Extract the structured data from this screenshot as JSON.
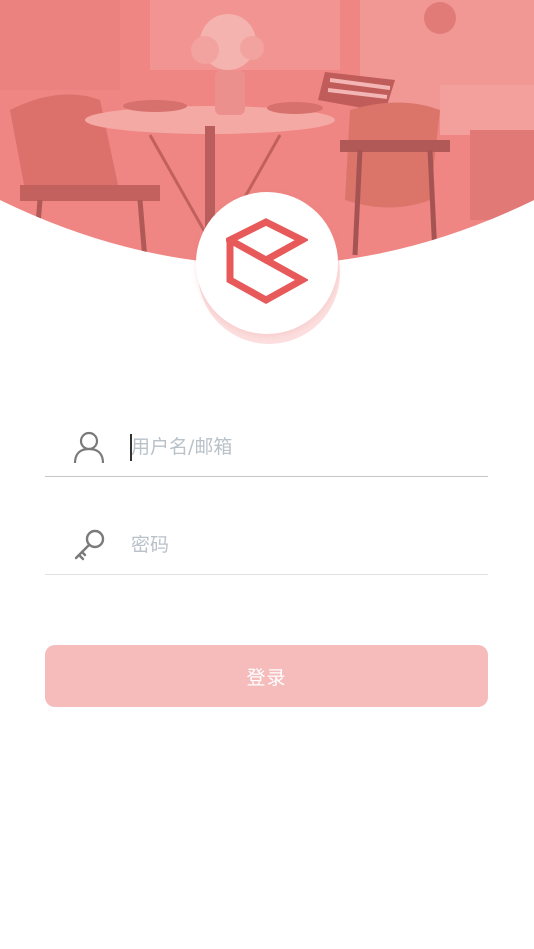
{
  "theme": {
    "accent": "#e85a5a",
    "header_overlay": "#f08080",
    "button_background": "#f6bcbc",
    "placeholder_color": "#b9c1c9",
    "icon_color": "#7a7a7a"
  },
  "header": {
    "background": "restaurant-photo",
    "logo_icon": "brand-logo-icon"
  },
  "login_form": {
    "username": {
      "icon": "user-icon",
      "value": "",
      "placeholder": "用户名/邮箱"
    },
    "password": {
      "icon": "key-icon",
      "value": "",
      "placeholder": "密码"
    },
    "submit_label": "登录"
  }
}
